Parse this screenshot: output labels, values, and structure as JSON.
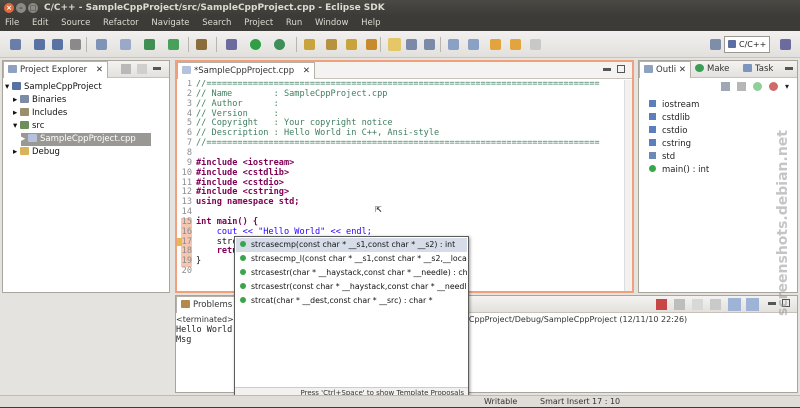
{
  "window": {
    "title": "C/C++ - SampleCppProject/src/SampleCppProject.cpp - Eclipse SDK"
  },
  "menu": [
    "File",
    "Edit",
    "Source",
    "Refactor",
    "Navigate",
    "Search",
    "Project",
    "Run",
    "Window",
    "Help"
  ],
  "perspective": {
    "label": "C/C++"
  },
  "project_explorer": {
    "tab": "Project Explorer",
    "items": [
      {
        "label": "SampleCppProject",
        "icon": "project-icon"
      },
      {
        "label": "Binaries",
        "icon": "binaries-icon"
      },
      {
        "label": "Includes",
        "icon": "includes-icon"
      },
      {
        "label": "src",
        "icon": "folder-icon"
      },
      {
        "label": "SampleCppProject.cpp",
        "icon": "cpp-file-icon"
      },
      {
        "label": "Debug",
        "icon": "folder-icon"
      }
    ]
  },
  "editor": {
    "tab": "*SampleCppProject.cpp",
    "lines": [
      "//============================================================================",
      "// Name        : SampleCppProject.cpp",
      "// Author      :",
      "// Version     :",
      "// Copyright   : Your copyright notice",
      "// Description : Hello World in C++, Ansi-style",
      "//============================================================================",
      "",
      "#include <iostream>",
      "#include <cstdlib>",
      "#include <cstdio>",
      "#include <cstring>",
      "using namespace std;",
      "",
      "int main() {",
      "    cout << \"Hello World\" << endl;",
      "    strca",
      "    return",
      "}",
      ""
    ]
  },
  "autocomplete": {
    "items": [
      "strcasecmp(const char * __s1,const char * __s2) : int",
      "strcasecmp_l(const char * __s1,const char * __s2,__locale_struct",
      "strcasestr(char * __haystack,const char * __needle) : char *",
      "strcasestr(const char * __haystack,const char * __needle) : const",
      "strcat(char * __dest,const char * __src) : char *"
    ],
    "hint": "Press 'Ctrl+Space' to show Template Proposals"
  },
  "outline": {
    "tabs": [
      "Outli",
      "Make",
      "Task"
    ],
    "items": [
      {
        "label": "iostream",
        "icon": "include-icon"
      },
      {
        "label": "cstdlib",
        "icon": "include-icon"
      },
      {
        "label": "cstdio",
        "icon": "include-icon"
      },
      {
        "label": "cstring",
        "icon": "include-icon"
      },
      {
        "label": "std",
        "icon": "namespace-icon"
      },
      {
        "label": "main() : int",
        "icon": "function-icon"
      }
    ]
  },
  "console": {
    "tab": "Problems",
    "status_left": "<terminated> Sa",
    "status_right": "eCppProject/Debug/SampleCppProject (12/11/10 22:26)",
    "output": [
      "Hello World",
      "Msg"
    ]
  },
  "statusbar": {
    "mode": "Writable",
    "insert": "Smart Insert",
    "position": "17 : 10"
  },
  "watermark": "screenshots.debian.net"
}
